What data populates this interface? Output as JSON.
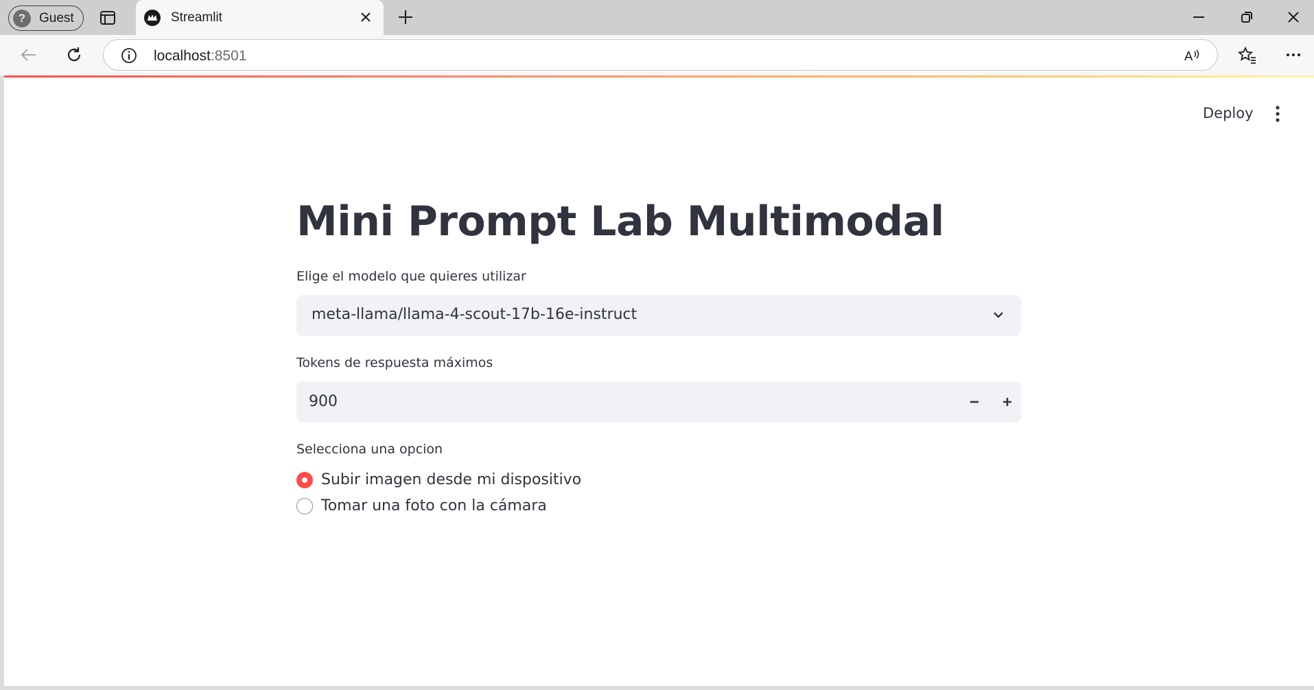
{
  "browser": {
    "profile_label": "Guest",
    "tab_title": "Streamlit",
    "url_host": "localhost",
    "url_port": ":8501"
  },
  "app_header": {
    "deploy_label": "Deploy"
  },
  "main": {
    "title": "Mini Prompt Lab Multimodal",
    "model_select": {
      "label": "Elige el modelo que quieres utilizar",
      "value": "meta-llama/llama-4-scout-17b-16e-instruct"
    },
    "tokens_input": {
      "label": "Tokens de respuesta máximos",
      "value": "900"
    },
    "option_radio": {
      "label": "Selecciona una opcion",
      "options": [
        {
          "label": "Subir imagen desde mi dispositivo",
          "selected": true
        },
        {
          "label": "Tomar una foto con la cámara",
          "selected": false
        }
      ]
    }
  },
  "colors": {
    "accent": "#ff4b4b",
    "text": "#31333f",
    "input_bg": "#f0f2f6"
  }
}
